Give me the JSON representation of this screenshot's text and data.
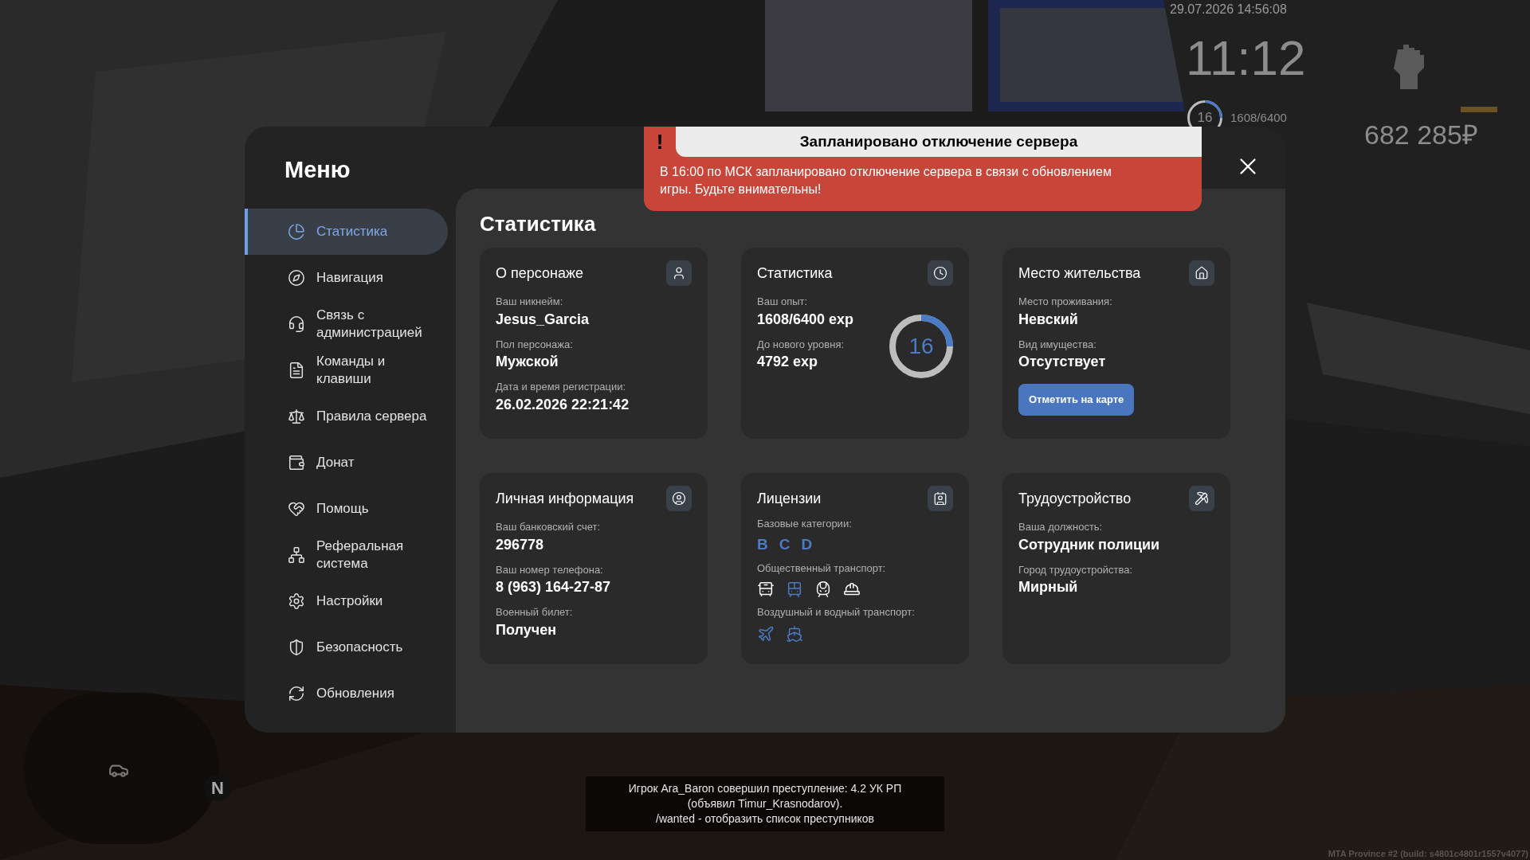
{
  "hud": {
    "date": "29.07.2026 14:56:08",
    "clock": "11:12",
    "level_text": "16",
    "level": 0.25,
    "exp": "1608/6400",
    "money": "682 285₽"
  },
  "menu": {
    "title": "Меню",
    "sidebar": {
      "items": [
        {
          "label": "Статистика",
          "selected": true
        },
        {
          "label": "Навигация",
          "selected": false
        },
        {
          "label": "Связь с администрацией",
          "selected": false
        },
        {
          "label": "Команды и клавиши",
          "selected": false
        },
        {
          "label": "Правила сервера",
          "selected": false
        },
        {
          "label": "Донат",
          "selected": false
        },
        {
          "label": "Помощь",
          "selected": false
        },
        {
          "label": "Реферальная система",
          "selected": false
        },
        {
          "label": "Настройки",
          "selected": false
        },
        {
          "label": "Безопасность",
          "selected": false
        },
        {
          "label": "Обновления",
          "selected": false
        }
      ]
    },
    "heading": "Статистика",
    "cards": [
      {
        "kind": "info",
        "title": "О персонаже",
        "fields": [
          {
            "label": "Ваш никнейм:",
            "value": "Jesus_Garcia"
          },
          {
            "label": "Пол персонажа:",
            "value": "Мужской"
          },
          {
            "label": "Дата и время регистрации:",
            "value": "26.02.2026 22:21:42"
          }
        ]
      },
      {
        "kind": "experience",
        "title": "Статистика",
        "fields": [
          {
            "label": "Ваш опыт:",
            "value": "1608/6400 exp"
          },
          {
            "label": "До нового уровня:",
            "value": "4792 exp"
          }
        ],
        "level_text": "16",
        "level": 0.25
      },
      {
        "kind": "info",
        "title": "Место жительства",
        "fields": [
          {
            "label": "Место проживания:",
            "value": "Невский"
          },
          {
            "label": "Вид имущества:",
            "value": "Отсутствует"
          }
        ],
        "button": "Отметить на карте"
      },
      {
        "kind": "info",
        "title": "Личная информация",
        "fields": [
          {
            "label": "Ваш банковский счет:",
            "value": "296778"
          },
          {
            "label": "Ваш номер телефона:",
            "value": "8 (963) 164-27-87"
          },
          {
            "label": "Военный билет:",
            "value": "Получен"
          }
        ]
      },
      {
        "kind": "licenses",
        "title": "Лицензии",
        "groups": [
          {
            "kind": "letters",
            "label": "Базовые категории:",
            "items": [
              {
                "text": "B",
                "held": true
              },
              {
                "text": "C",
                "held": true
              },
              {
                "text": "D",
                "held": true
              }
            ]
          },
          {
            "kind": "public",
            "label": "Общественный транспорт:",
            "items": [
              {
                "held": false
              },
              {
                "held": true
              },
              {
                "held": false
              },
              {
                "held": false
              }
            ]
          },
          {
            "kind": "air_water",
            "label": "Воздушный и водный транспорт:",
            "items": [
              {
                "held": true
              },
              {
                "held": true
              }
            ]
          }
        ]
      },
      {
        "kind": "info",
        "title": "Трудоустройство",
        "fields": [
          {
            "label": "Ваша должность:",
            "value": "Сотрудник полиции"
          },
          {
            "label": "Город трудоустройства:",
            "value": "Мирный"
          }
        ]
      }
    ]
  },
  "notification": {
    "mark": "!",
    "title": "Запланировано отключение сервера",
    "text": "В 16:00 по МСК запланировано отключение сервера в связи с обновлением игры. Будьте внимательны!"
  },
  "minimap": {
    "north": "N"
  },
  "chat": [
    "Игрок Ara_Baron совершил преступление: 4.2 УК РП",
    "(объявил Timur_Krasnodarov).",
    "/wanted - отобразить список преступников"
  ],
  "build": "MTA Province #2 (build: s4801c4801r1557v4077)"
}
